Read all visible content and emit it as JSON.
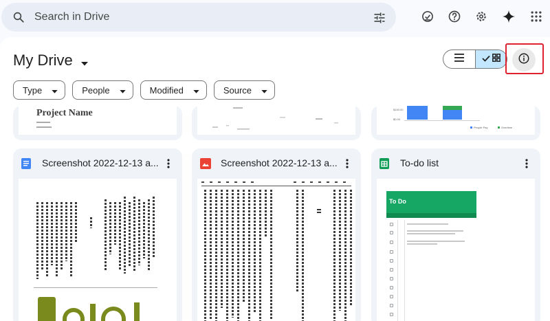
{
  "search": {
    "placeholder": "Search in Drive"
  },
  "header": {
    "title": "My Drive",
    "icons": [
      "search-icon",
      "tune-icon",
      "ready-offline-icon",
      "help-icon",
      "settings-icon",
      "gemini-sparkle-icon",
      "apps-grid-icon"
    ]
  },
  "view": {
    "selected": "grid",
    "highlighted_control": "details-info"
  },
  "filters": [
    {
      "label": "Type"
    },
    {
      "label": "People"
    },
    {
      "label": "Modified"
    },
    {
      "label": "Source"
    }
  ],
  "files_top": [
    {
      "preview_text": "Project Name",
      "type": "doc"
    },
    {
      "type": "chart"
    },
    {
      "axis": [
        "$100.00",
        "$0.00"
      ],
      "legend": [
        "People Pay",
        "Overtime"
      ],
      "type": "bar-chart"
    }
  ],
  "files": [
    {
      "name": "Screenshot 2022-12-13 a...",
      "type": "doc",
      "icon_color": "#4285f4"
    },
    {
      "name": "Screenshot 2022-12-13 a...",
      "type": "image",
      "icon_color": "#ea4335"
    },
    {
      "name": "To-do list",
      "type": "sheet",
      "icon_color": "#0f9d58",
      "preview": {
        "title": "To Do"
      }
    }
  ],
  "colors": {
    "accent_selected": "#c2e7ff",
    "highlight": "#e0212f",
    "search_bg": "#e9eef6"
  }
}
